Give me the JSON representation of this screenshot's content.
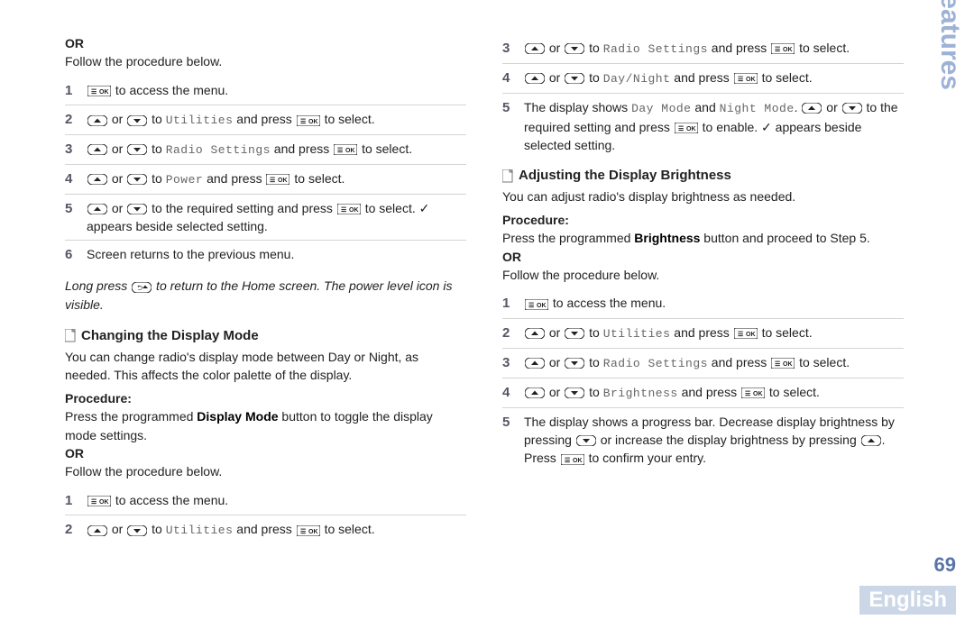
{
  "sidebar_title": "Advanced Features",
  "page_number": "69",
  "language": "English",
  "left": {
    "or1": "OR",
    "follow1": "Follow the procedure below.",
    "steps_a": [
      {
        "n": "1",
        "prefix": "",
        "t1": " to access the menu."
      },
      {
        "n": "2",
        "t_mid1": " or ",
        "t_to": " to ",
        "code": "Utilities",
        "t_and": " and press ",
        "t_end": " to select."
      },
      {
        "n": "3",
        "t_mid1": " or ",
        "t_to": " to ",
        "code": "Radio Settings",
        "t_and": " and press ",
        "t_end": " to select."
      },
      {
        "n": "4",
        "t_mid1": " or ",
        "t_to": " to ",
        "code": "Power",
        "t_and": " and press ",
        "t_end": " to select."
      },
      {
        "n": "5",
        "t_mid1": " or ",
        "t_to": " to the required setting and press ",
        "t_end": " to select. ✓ appears beside selected setting."
      },
      {
        "n": "6",
        "plain": "Screen returns to the previous menu."
      }
    ],
    "note_a": "Long press ",
    "note_b": " to return to the Home screen. The power level icon is visible.",
    "sub_display_mode": "Changing the Display Mode",
    "dm_intro": "You can change radio's display mode between Day or Night, as needed. This affects the color palette of the display.",
    "procedure": "Procedure:",
    "dm_press_a": "Press the programmed ",
    "dm_press_b": "Display Mode",
    "dm_press_c": " button to toggle the display mode settings.",
    "or2": "OR",
    "follow2": "Follow the procedure below.",
    "steps_b": [
      {
        "n": "1",
        "t1": " to access the menu."
      },
      {
        "n": "2",
        "t_mid1": " or ",
        "t_to": " to ",
        "code": "Utilities",
        "t_and": " and press ",
        "t_end": " to select."
      }
    ]
  },
  "right": {
    "steps_top": [
      {
        "n": "3",
        "t_mid1": " or ",
        "t_to": " to ",
        "code": "Radio Settings",
        "t_and": " and press ",
        "t_end": " to select."
      },
      {
        "n": "4",
        "t_mid1": " or ",
        "t_to": " to ",
        "code": "Day/Night",
        "t_and": " and press ",
        "t_end": " to select."
      }
    ],
    "step5_a": "The display shows ",
    "step5_code1": "Day Mode",
    "step5_b": " and ",
    "step5_code2": "Night Mode",
    "step5_c": ". ",
    "step5_d": " or ",
    "step5_e": " to the required setting and press ",
    "step5_f": " to enable. ✓ appears beside selected setting.",
    "sub_brightness": "Adjusting the Display Brightness",
    "br_intro": "You can adjust radio's display brightness as needed.",
    "procedure": "Procedure:",
    "br_press_a": "Press the programmed ",
    "br_press_b": "Brightness",
    "br_press_c": " button and proceed to Step 5.",
    "or": "OR",
    "follow": "Follow the procedure below.",
    "steps_b": [
      {
        "n": "1",
        "t1": " to access the menu."
      },
      {
        "n": "2",
        "t_mid1": " or ",
        "t_to": " to ",
        "code": "Utilities",
        "t_and": " and press ",
        "t_end": " to select."
      },
      {
        "n": "3",
        "t_mid1": " or ",
        "t_to": " to ",
        "code": "Radio Settings",
        "t_and": " and press ",
        "t_end": " to select."
      },
      {
        "n": "4",
        "t_mid1": " or ",
        "t_to": " to ",
        "code": "Brightness",
        "t_and": " and press ",
        "t_end": " to select."
      }
    ],
    "step5b_a": "The display shows a progress bar. Decrease display brightness by pressing ",
    "step5b_b": " or increase the display brightness by pressing ",
    "step5b_c": ". Press ",
    "step5b_d": " to confirm your entry."
  }
}
